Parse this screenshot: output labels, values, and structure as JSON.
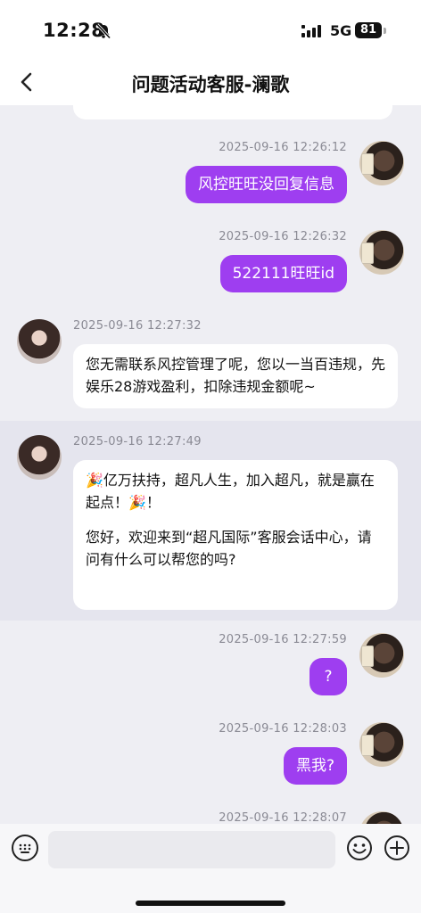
{
  "status_bar": {
    "time": "12:28",
    "bell_icon": "bell-slash-icon",
    "network": "5G",
    "battery": "81"
  },
  "header": {
    "back_icon": "chevron-left-icon",
    "title": "问题活动客服-澜歌"
  },
  "messages": [
    {
      "side": "out",
      "time": "2025-09-16 12:26:12",
      "text": "风控旺旺没回复信息"
    },
    {
      "side": "out",
      "time": "2025-09-16 12:26:32",
      "text": "522111旺旺id"
    },
    {
      "side": "in",
      "time": "2025-09-16 12:27:32",
      "text": "您无需联系风控管理了呢，您以一当百违规，先娱乐28游戏盈利，扣除违规金额呢~"
    },
    {
      "side": "in",
      "time": "2025-09-16 12:27:49",
      "text_line1": "🎉亿万扶持，超凡人生，加入超凡，就是赢在起点！🎉！",
      "text_line2": "您好，欢迎来到“超凡国际”客服会话中心，请问有什么可以帮您的吗?"
    },
    {
      "side": "out",
      "time": "2025-09-16 12:27:59",
      "text": "?"
    },
    {
      "side": "out",
      "time": "2025-09-16 12:28:03",
      "text": "黑我?"
    },
    {
      "side": "out",
      "time": "2025-09-16 12:28:07",
      "text": ""
    }
  ],
  "input_bar": {
    "keyboard_icon": "keyboard-icon",
    "placeholder": "",
    "emoji_icon": "emoji-smile-icon",
    "add_icon": "plus-circle-icon"
  },
  "colors": {
    "accent": "#9e3ef0",
    "chat_background": "#eeeef3",
    "bubble_in": "#ffffff"
  }
}
